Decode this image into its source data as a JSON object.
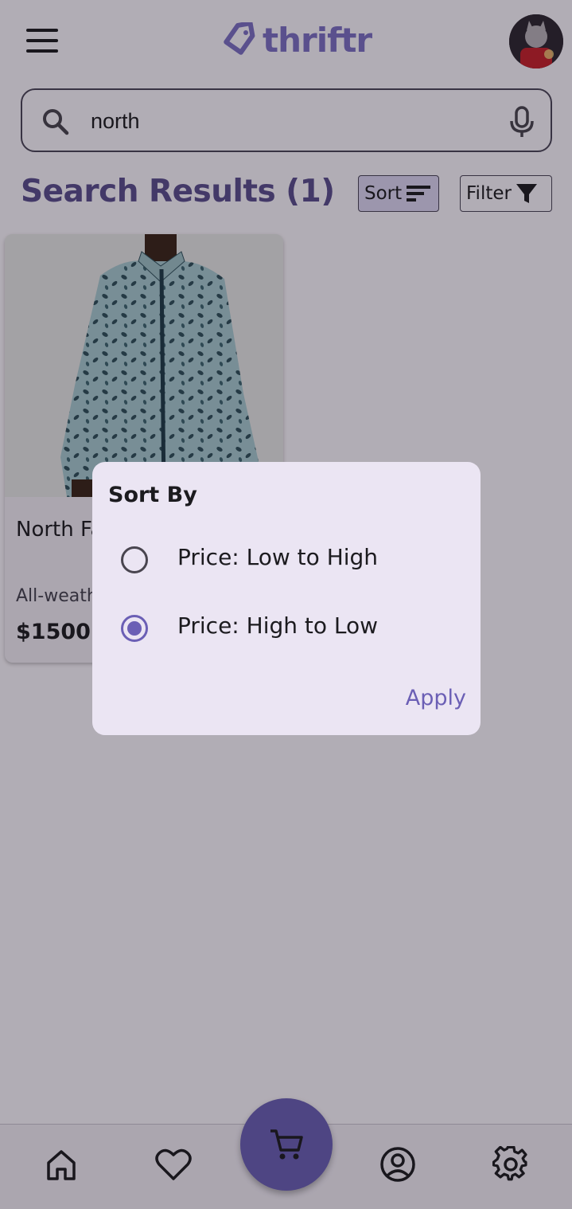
{
  "app": {
    "name": "thriftr"
  },
  "header": {
    "menu_icon": "hamburger-menu-icon",
    "logo_icon": "tag-icon",
    "logo_text": "thriftr",
    "avatar": "user-avatar"
  },
  "search": {
    "icon": "search-icon",
    "value": "north",
    "mic_icon": "microphone-icon"
  },
  "results": {
    "title": "Search Results (1)",
    "sort_label": "Sort",
    "sort_icon": "sort-lines-icon",
    "filter_label": "Filter",
    "filter_icon": "funnel-icon"
  },
  "products": [
    {
      "name": "North Face Jacket",
      "description": "All-weather jacket",
      "price": "$1500.00"
    }
  ],
  "dialog": {
    "title": "Sort By",
    "options": [
      {
        "label": "Price: Low to High",
        "selected": false
      },
      {
        "label": "Price: High to Low",
        "selected": true
      }
    ],
    "apply_label": "Apply"
  },
  "bottom_nav": {
    "items": [
      {
        "icon": "home-icon"
      },
      {
        "icon": "heart-icon"
      },
      {
        "icon": "cart-icon"
      },
      {
        "icon": "account-circle-icon"
      },
      {
        "icon": "settings-gear-icon"
      }
    ]
  },
  "colors": {
    "primary": "#6b5fb5",
    "title": "#5b4d8e",
    "logo": "#7c6fc4",
    "surface": "#fdf8ff",
    "dialog_surface": "#ebe5f3",
    "scrim": "rgba(18,14,26,0.32)"
  }
}
